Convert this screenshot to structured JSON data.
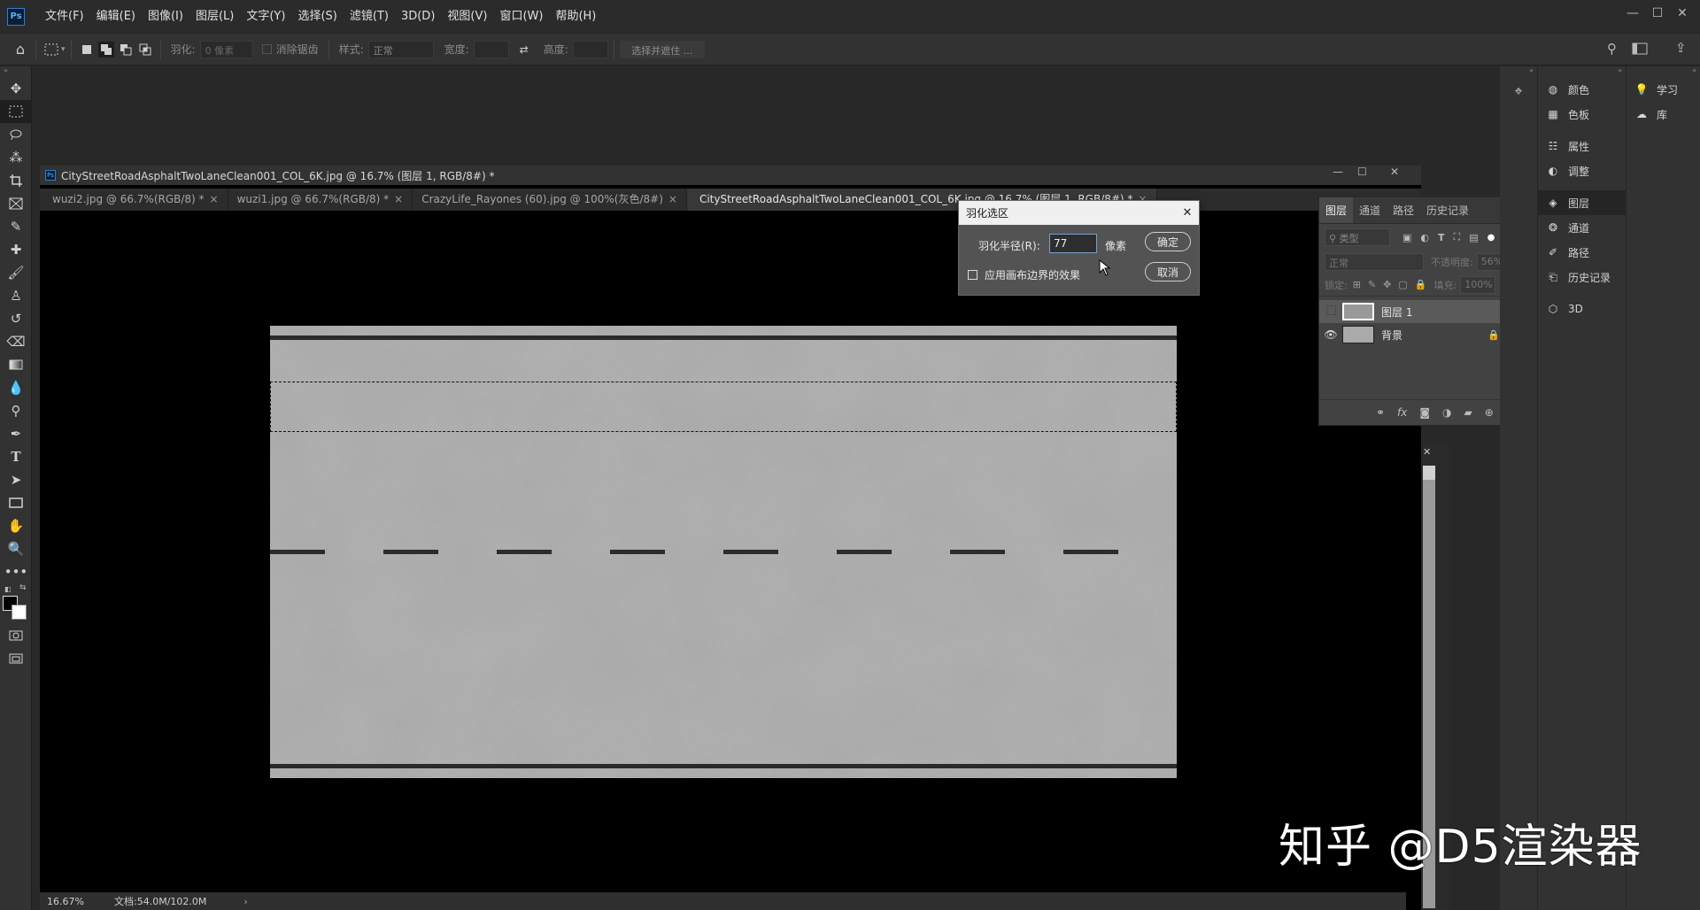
{
  "menubar": {
    "logo": "Ps",
    "items": [
      "文件(F)",
      "编辑(E)",
      "图像(I)",
      "图层(L)",
      "文字(Y)",
      "选择(S)",
      "滤镜(T)",
      "3D(D)",
      "视图(V)",
      "窗口(W)",
      "帮助(H)"
    ],
    "minimize": "—",
    "maximize": "☐",
    "close": "✕"
  },
  "options": {
    "feather_label": "羽化:",
    "feather_value": "0 像素",
    "antialias_label": "消除锯齿",
    "style_label": "样式:",
    "style_value": "正常",
    "width_label": "宽度:",
    "height_label": "高度:",
    "select_mask": "选择并遮住 ..."
  },
  "document": {
    "window_title": "CityStreetRoadAsphaltTwoLaneClean001_COL_6K.jpg @ 16.7% (图层 1, RGB/8#) *",
    "tabs": [
      {
        "label": "wuzi2.jpg @ 66.7%(RGB/8) *",
        "close": "×"
      },
      {
        "label": "wuzi1.jpg @ 66.7%(RGB/8) *",
        "close": "×"
      },
      {
        "label": "CrazyLife_Rayones (60).jpg @ 100%(灰色/8#)",
        "close": "×"
      },
      {
        "label": "CityStreetRoadAsphaltTwoLaneClean001_COL_6K.jpg @ 16.7% (图层 1, RGB/8#) *",
        "close": "×"
      }
    ],
    "zoom": "16.67%",
    "doc_size": "文档:54.0M/102.0M",
    "status_arrow": "›"
  },
  "dialog": {
    "title": "羽化选区",
    "radius_label": "羽化半径(R):",
    "radius_value": "77",
    "unit": "像素",
    "ok": "确定",
    "cancel": "取消",
    "canvas_edge_label": "应用画布边界的效果",
    "close": "✕"
  },
  "layers_panel": {
    "tabs": [
      "图层",
      "通道",
      "路径",
      "历史记录"
    ],
    "kind_filter": "类型",
    "blend_mode": "正常",
    "opacity_label": "不透明度:",
    "opacity_value": "56%",
    "lock_label": "锁定:",
    "fill_label": "填充:",
    "fill_value": "100%",
    "layers": [
      {
        "name": "图层 1",
        "visible": false,
        "selected": true
      },
      {
        "name": "背景",
        "visible": true,
        "selected": false,
        "locked": true
      }
    ]
  },
  "dock_mid": [
    "颜色",
    "色板",
    "属性",
    "调整",
    "图层",
    "通道",
    "路径",
    "历史记录",
    "3D"
  ],
  "dock_right": [
    "学习",
    "库"
  ],
  "watermark": "知乎 @D5渲染器",
  "icons": {
    "home": "⌂",
    "search": "⚲",
    "share": "⇪",
    "ps_logo": "Ps"
  }
}
